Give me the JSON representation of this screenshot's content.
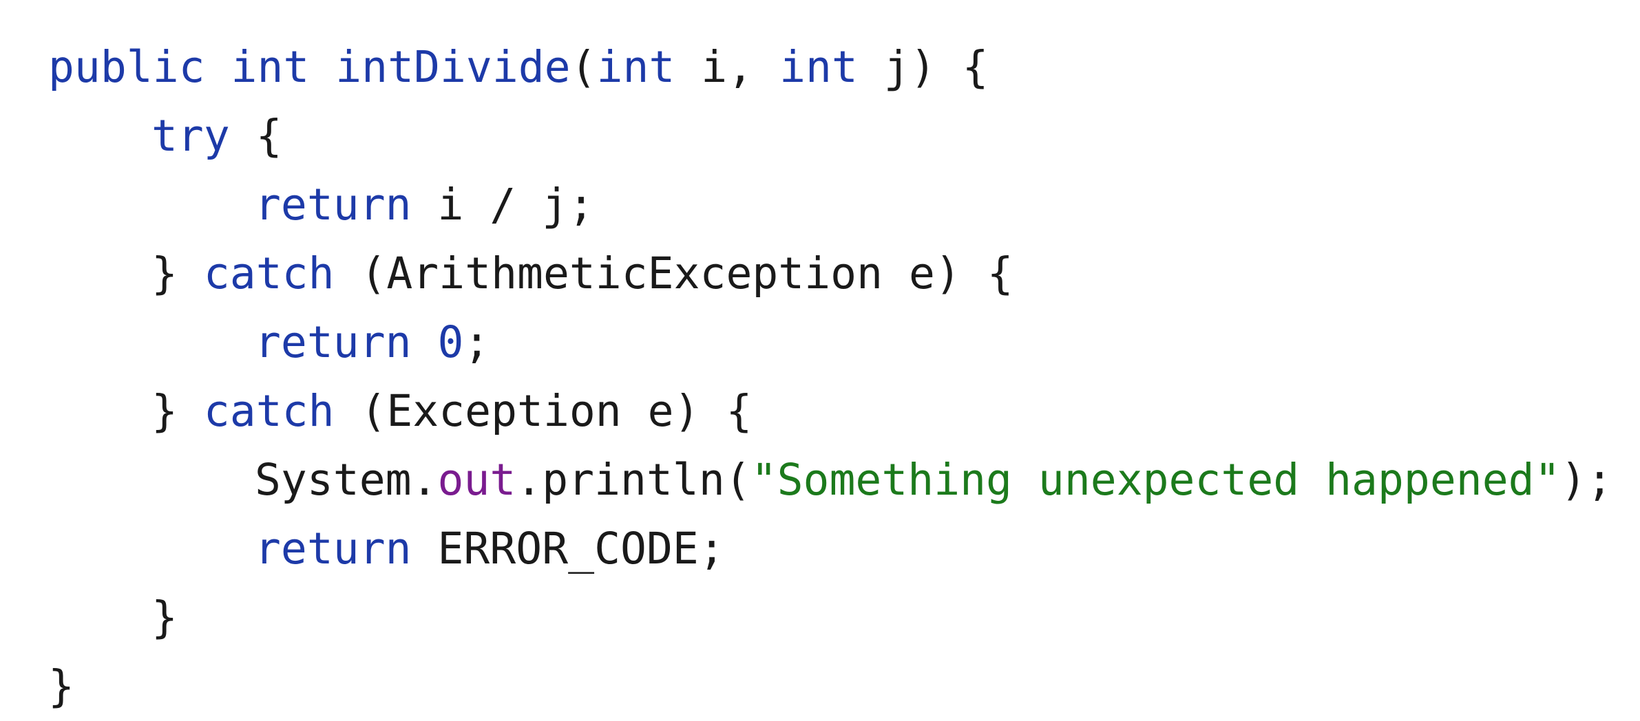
{
  "colors": {
    "background": "#ffffff",
    "plain": "#1a1a1a",
    "keyword": "#1d3aa8",
    "field": "#7a1c8f",
    "string": "#1c7a1c",
    "number": "#1d3aa8"
  },
  "code": {
    "language": "Java",
    "lines": [
      {
        "tokens": [
          {
            "kind": "keyword",
            "text": "public"
          },
          {
            "kind": "plain",
            "text": " "
          },
          {
            "kind": "keyword",
            "text": "int"
          },
          {
            "kind": "plain",
            "text": " "
          },
          {
            "kind": "keyword",
            "text": "intDivide"
          },
          {
            "kind": "plain",
            "text": "("
          },
          {
            "kind": "keyword",
            "text": "int"
          },
          {
            "kind": "plain",
            "text": " i, "
          },
          {
            "kind": "keyword",
            "text": "int"
          },
          {
            "kind": "plain",
            "text": " j) {"
          }
        ]
      },
      {
        "tokens": [
          {
            "kind": "keyword",
            "text": "try"
          },
          {
            "kind": "plain",
            "text": " {"
          }
        ]
      },
      {
        "tokens": [
          {
            "kind": "keyword",
            "text": "return"
          },
          {
            "kind": "plain",
            "text": " i / j;"
          }
        ]
      },
      {
        "tokens": [
          {
            "kind": "plain",
            "text": "} "
          },
          {
            "kind": "keyword",
            "text": "catch"
          },
          {
            "kind": "plain",
            "text": " (ArithmeticException e) {"
          }
        ]
      },
      {
        "tokens": [
          {
            "kind": "keyword",
            "text": "return"
          },
          {
            "kind": "plain",
            "text": " "
          },
          {
            "kind": "number",
            "text": "0"
          },
          {
            "kind": "plain",
            "text": ";"
          }
        ]
      },
      {
        "tokens": [
          {
            "kind": "plain",
            "text": "} "
          },
          {
            "kind": "keyword",
            "text": "catch"
          },
          {
            "kind": "plain",
            "text": " (Exception e) {"
          }
        ]
      },
      {
        "tokens": [
          {
            "kind": "plain",
            "text": "System."
          },
          {
            "kind": "field",
            "text": "out"
          },
          {
            "kind": "plain",
            "text": ".println("
          },
          {
            "kind": "string",
            "text": "\"Something unexpected happened\""
          },
          {
            "kind": "plain",
            "text": ");"
          }
        ]
      },
      {
        "tokens": [
          {
            "kind": "keyword",
            "text": "return"
          },
          {
            "kind": "plain",
            "text": " ERROR_CODE;"
          }
        ]
      },
      {
        "tokens": [
          {
            "kind": "plain",
            "text": "}"
          }
        ]
      },
      {
        "tokens": [
          {
            "kind": "plain",
            "text": "}"
          }
        ]
      }
    ]
  }
}
